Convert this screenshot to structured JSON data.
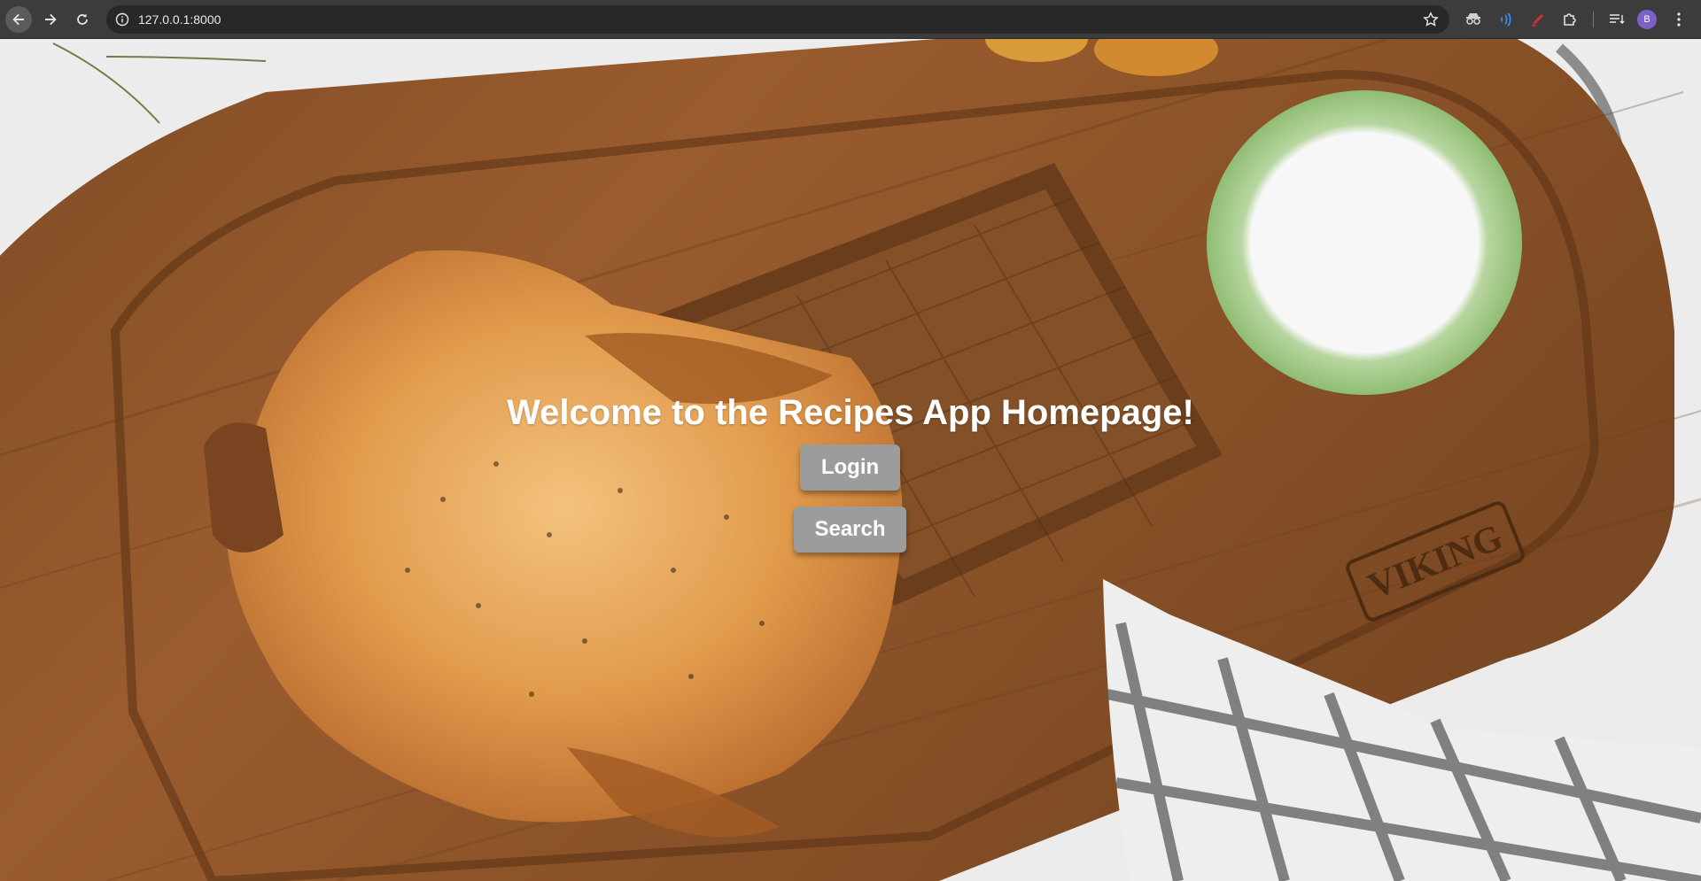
{
  "browser": {
    "url": "127.0.0.1:8000",
    "avatar_initial": "B",
    "icons": [
      "back-icon",
      "forward-icon",
      "reload-icon",
      "site-info-icon",
      "bookmark-star-icon",
      "extension-icons",
      "puzzle-extensions-icon",
      "reading-list-icon",
      "kebab-menu-icon"
    ]
  },
  "page": {
    "heading": "Welcome to the Recipes App Homepage!",
    "login_label": "Login",
    "search_label": "Search",
    "background": "roasted chicken on wooden cutting board",
    "board_brand": "VIKING",
    "colors": {
      "button_bg": "#9c9c9c",
      "heading_color": "#ffffff",
      "toolbar_bg": "#3c3c3c"
    }
  }
}
